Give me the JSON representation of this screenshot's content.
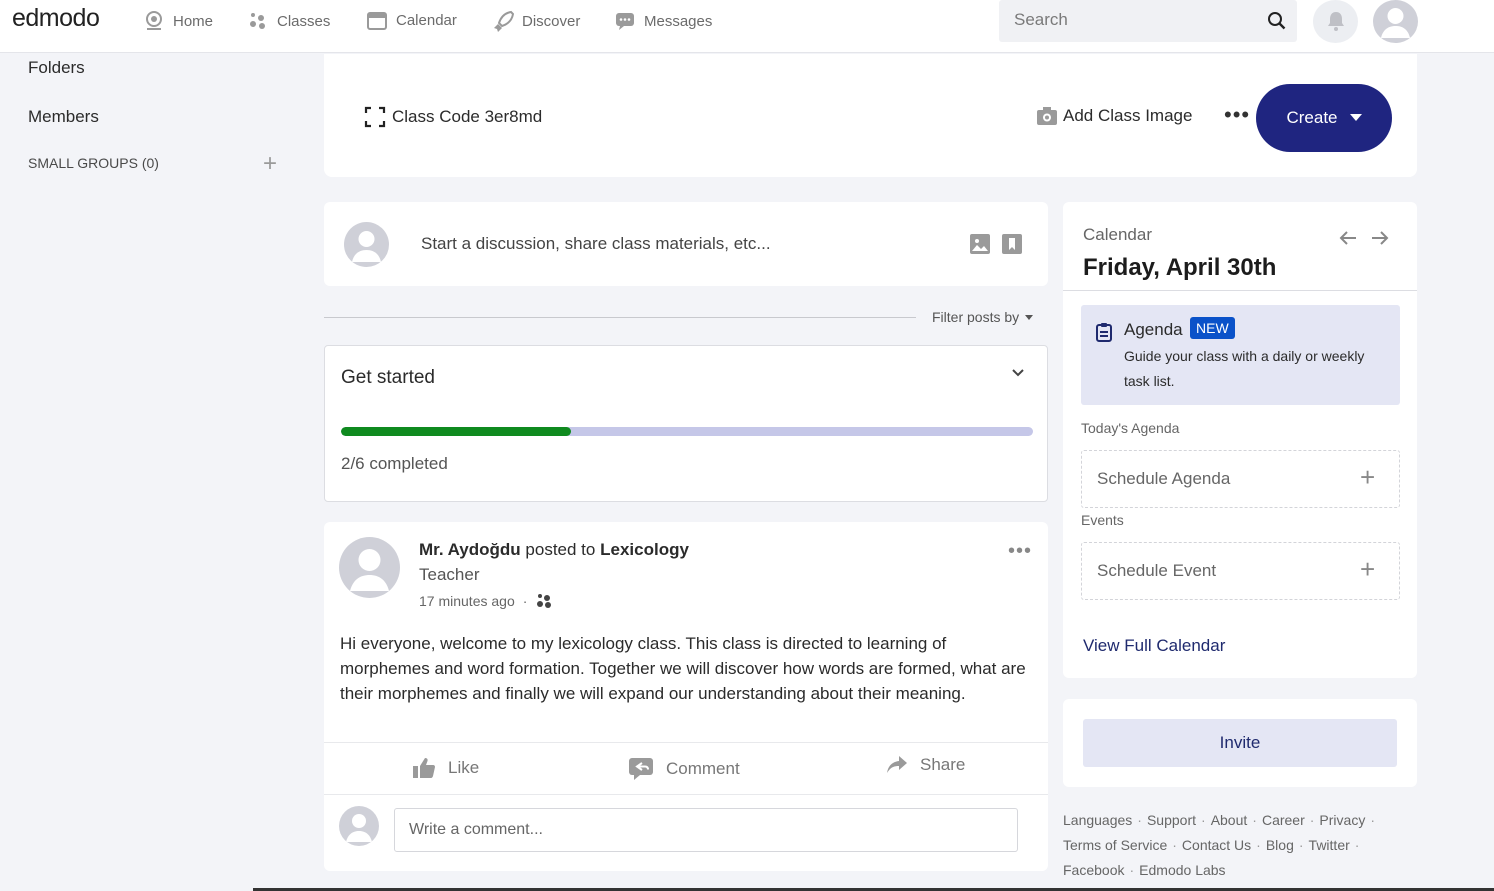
{
  "app": {
    "logo": "edmodo"
  },
  "nav": {
    "items": [
      {
        "label": "Home",
        "icon": "home-icon"
      },
      {
        "label": "Classes",
        "icon": "classes-icon"
      },
      {
        "label": "Calendar",
        "icon": "calendar-icon"
      },
      {
        "label": "Discover",
        "icon": "rocket-icon"
      },
      {
        "label": "Messages",
        "icon": "message-icon"
      }
    ],
    "search_placeholder": "Search"
  },
  "sidebar": {
    "folders": "Folders",
    "members": "Members",
    "small_groups": "SMALL GROUPS (0)"
  },
  "class_header": {
    "class_code": "Class Code 3er8md",
    "add_image": "Add Class Image",
    "create_label": "Create"
  },
  "composer": {
    "placeholder": "Start a discussion, share class materials, etc..."
  },
  "filter": {
    "label": "Filter posts by"
  },
  "get_started": {
    "title": "Get started",
    "completed_text": "2/6 completed",
    "progress_fraction": 0.333
  },
  "post": {
    "author": "Mr. Aydoğdu",
    "posted_to": "posted to",
    "class_name": "Lexicology",
    "role": "Teacher",
    "time": "17 minutes ago",
    "separator": "·",
    "body": "Hi everyone, welcome to my lexicology class. This class is directed to learning of morphemes and word formation. Together we will discover how words are formed, what are their morphemes and finally we will expand our understanding about their meaning.",
    "actions": {
      "like": "Like",
      "comment": "Comment",
      "share": "Share"
    },
    "comment_placeholder": "Write a comment..."
  },
  "calendar": {
    "label": "Calendar",
    "date": "Friday, April 30th",
    "agenda_title": "Agenda",
    "agenda_badge": "NEW",
    "agenda_desc": "Guide your class with a daily or weekly task list.",
    "today_agenda": "Today's Agenda",
    "schedule_agenda": "Schedule Agenda",
    "events": "Events",
    "schedule_event": "Schedule Event",
    "view_full": "View Full Calendar"
  },
  "invite": {
    "label": "Invite"
  },
  "footer": {
    "links": [
      "Languages",
      "Support",
      "About",
      "Career",
      "Privacy",
      "Terms of Service",
      "Contact Us",
      "Blog",
      "Twitter",
      "Facebook",
      "Edmodo Labs"
    ],
    "separator": "·"
  },
  "colors": {
    "primary": "#1f2580",
    "progress": "#0f8a1f",
    "badge": "#0a52c9"
  }
}
